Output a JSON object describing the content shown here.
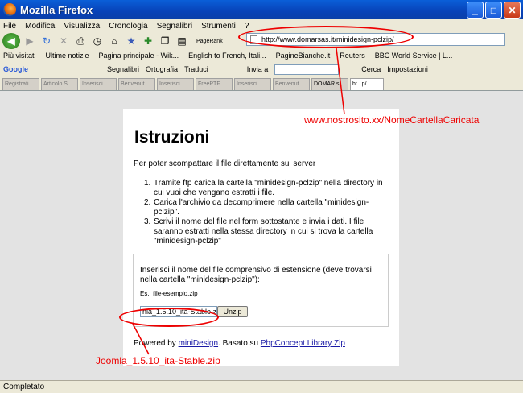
{
  "window": {
    "title": "Mozilla Firefox"
  },
  "menu": [
    "File",
    "Modifica",
    "Visualizza",
    "Cronologia",
    "Segnalibri",
    "Strumenti",
    "?"
  ],
  "nav": {
    "url": "http://www.domarsas.it/minidesign-pclzip/",
    "pagerank_label": "PageRank"
  },
  "bookmarks": [
    "Più visitati",
    "Ultime notizie",
    "Pagina principale - Wik...",
    "English to French, Itali...",
    "PagineBianche.it",
    "Reuters",
    "BBC World Service | L..."
  ],
  "googlebar": {
    "logo": "Google",
    "segnalibri": "Segnalibri",
    "ortografia": "Ortografia",
    "traduci": "Traduci",
    "invia": "Invia a",
    "cerca": "Cerca",
    "impostazioni": "Impostazioni"
  },
  "tabs": [
    "Registrati",
    "Articolo S...",
    "Inserisci...",
    "Benvenut...",
    "Inserisci...",
    "FreePTF",
    "Inserisci...",
    "Benvenut...",
    "DOMAR s...",
    "ht...p/"
  ],
  "page": {
    "title": "Istruzioni",
    "intro": "Per poter scompattare il file direttamente sul server",
    "steps": [
      {
        "n": "1.",
        "text": "Tramite ftp carica la cartella \"minidesign-pclzip\" nella directory in cui vuoi che vengano estratti i file."
      },
      {
        "n": "2.",
        "text": "Carica l'archivio da decomprimere nella cartella \"minidesign-pclzip\"."
      },
      {
        "n": "3.",
        "text": "Scrivi il nome del file nel form sottostante e invia i dati. I file saranno estratti nella stessa directory in cui si trova la cartella \"minidesign-pclzip\""
      }
    ],
    "form_label": "Inserisci il nome del file comprensivo di estensione (deve trovarsi nella cartella \"minidesign-pclzip\"):",
    "example": "Es.: file-esempio.zip",
    "input_value": "nla_1.5.10_ita-Stable.zip",
    "button": "Unzip",
    "powered_prefix": "Powered by",
    "powered_link": "miniDesign",
    "based_prefix": ". Basato su",
    "based_link": "PhpConcept Library Zip"
  },
  "annotations": {
    "url_note": "www.nostrosito.xx/NomeCartellaCaricata",
    "file_note": "Joomla_1.5.10_ita-Stable.zip"
  },
  "status": {
    "text": "Completato"
  },
  "colors": {
    "annotation": "#e00000",
    "link": "#1a1aa6",
    "titlebar": "#0a5fd8"
  }
}
